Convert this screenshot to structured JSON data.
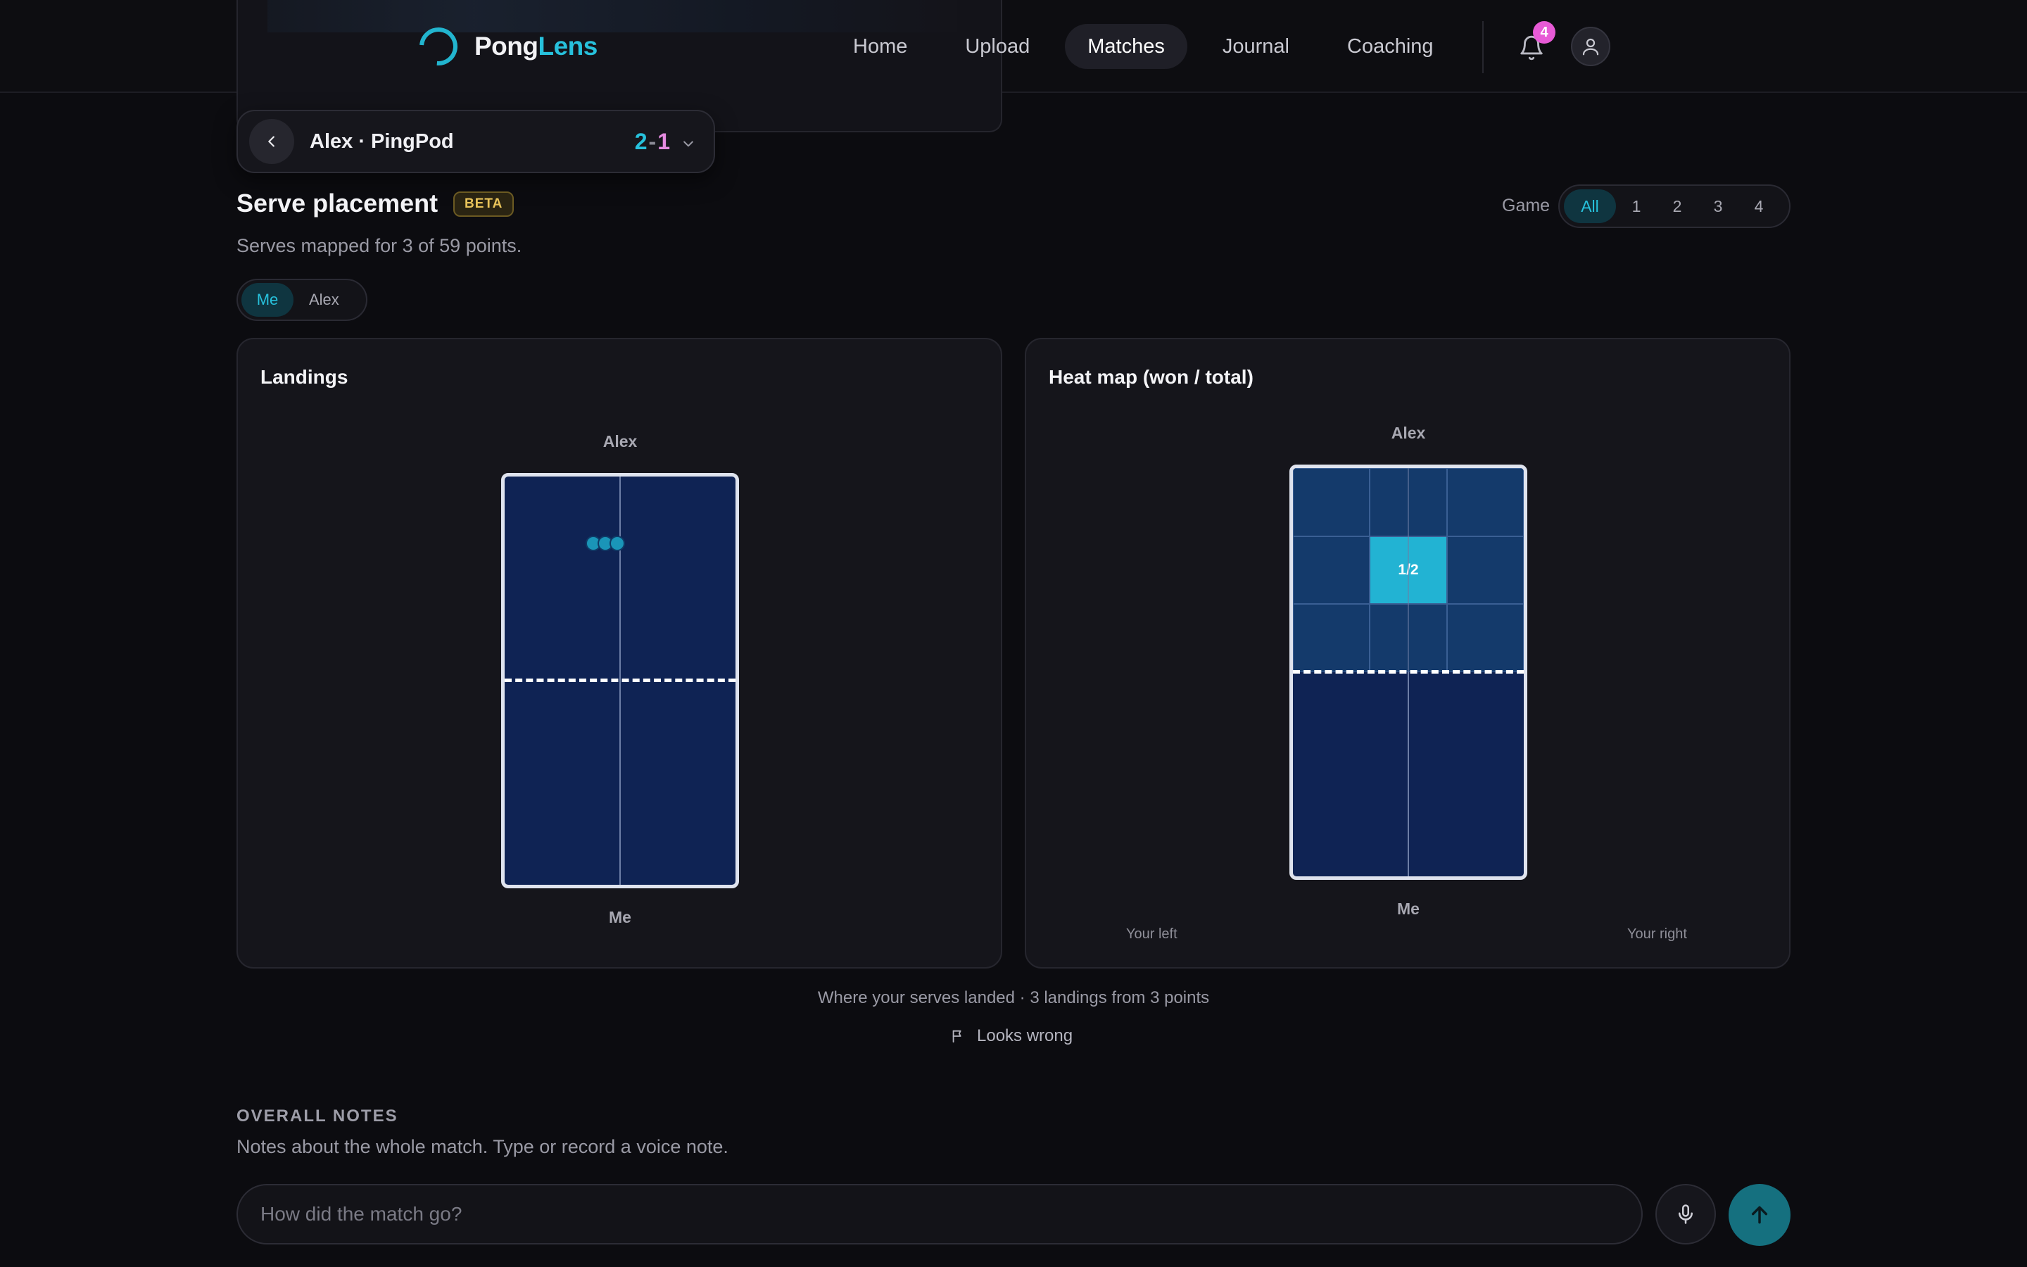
{
  "app": {
    "brand_part1": "Pong",
    "brand_part2": "Lens",
    "nav": [
      {
        "label": "Home",
        "active": false
      },
      {
        "label": "Upload",
        "active": false
      },
      {
        "label": "Matches",
        "active": true
      },
      {
        "label": "Journal",
        "active": false
      },
      {
        "label": "Coaching",
        "active": false
      }
    ],
    "notifications_count": "4",
    "icons": [
      "logo-icon",
      "bell-icon",
      "user-icon"
    ]
  },
  "match": {
    "title": "Alex · PingPod",
    "score_me": "2",
    "score_sep": "-",
    "score_opp": "1"
  },
  "serve_placement": {
    "title": "Serve placement",
    "badge": "BETA",
    "subtitle": "Serves mapped for 3 of 59 points.",
    "game_label": "Game",
    "game_options": [
      "All",
      "1",
      "2",
      "3",
      "4"
    ],
    "game_selected": "All",
    "player_options": [
      "Me",
      "Alex"
    ],
    "player_selected": "Me"
  },
  "landings": {
    "title": "Landings",
    "top_label": "Alex",
    "bottom_label": "Me",
    "dot_count": 3
  },
  "heatmap": {
    "title": "Heat map (won / total)",
    "top_label": "Alex",
    "bottom_label": "Me",
    "left_label": "Your left",
    "right_label": "Your right",
    "cells": [
      "",
      "",
      "",
      "",
      "1/2",
      "",
      "",
      "",
      ""
    ],
    "hot_index": 4
  },
  "caption": "Where your serves landed · 3 landings from 3 points",
  "looks_wrong": "Looks wrong",
  "notes": {
    "label": "OVERALL NOTES",
    "subtitle": "Notes about the whole match. Type or record a voice note.",
    "placeholder": "How did the match go?"
  },
  "colors": {
    "accent": "#27c1dc",
    "opponent": "#e58be0",
    "table": "#0f2354",
    "heat_hot": "#22b3d3",
    "badge": "#e75ad6"
  }
}
